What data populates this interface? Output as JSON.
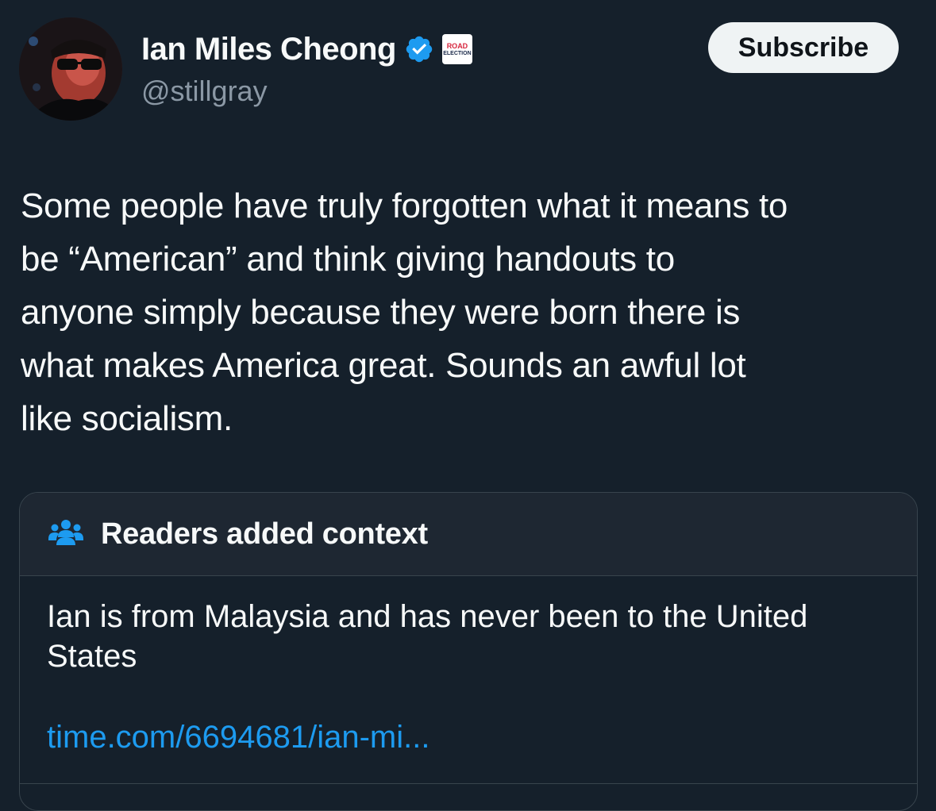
{
  "author": {
    "display_name": "Ian Miles Cheong",
    "handle": "@stillgray",
    "verified_icon": "verified-badge-icon",
    "affiliate_badge": {
      "line1": "ROAD",
      "line2": "ELECTION"
    }
  },
  "subscribe_label": "Subscribe",
  "tweet": {
    "lines": [
      "Some people have truly forgotten what it means to",
      "be “American” and think giving handouts to",
      "anyone simply because they were born there is",
      "what makes America great. Sounds an awful lot",
      "like socialism."
    ]
  },
  "community_note": {
    "icon": "people-group-icon",
    "title": "Readers added context",
    "body_lines": [
      "Ian is from Malaysia and has never been to the United",
      "States"
    ],
    "link_text": "time.com/6694681/ian-mi..."
  },
  "colors": {
    "background": "#15202b",
    "verified_blue": "#1d9bf0",
    "link_blue": "#1d9bf0",
    "secondary_text": "#8b98a5",
    "border": "#38444d"
  }
}
